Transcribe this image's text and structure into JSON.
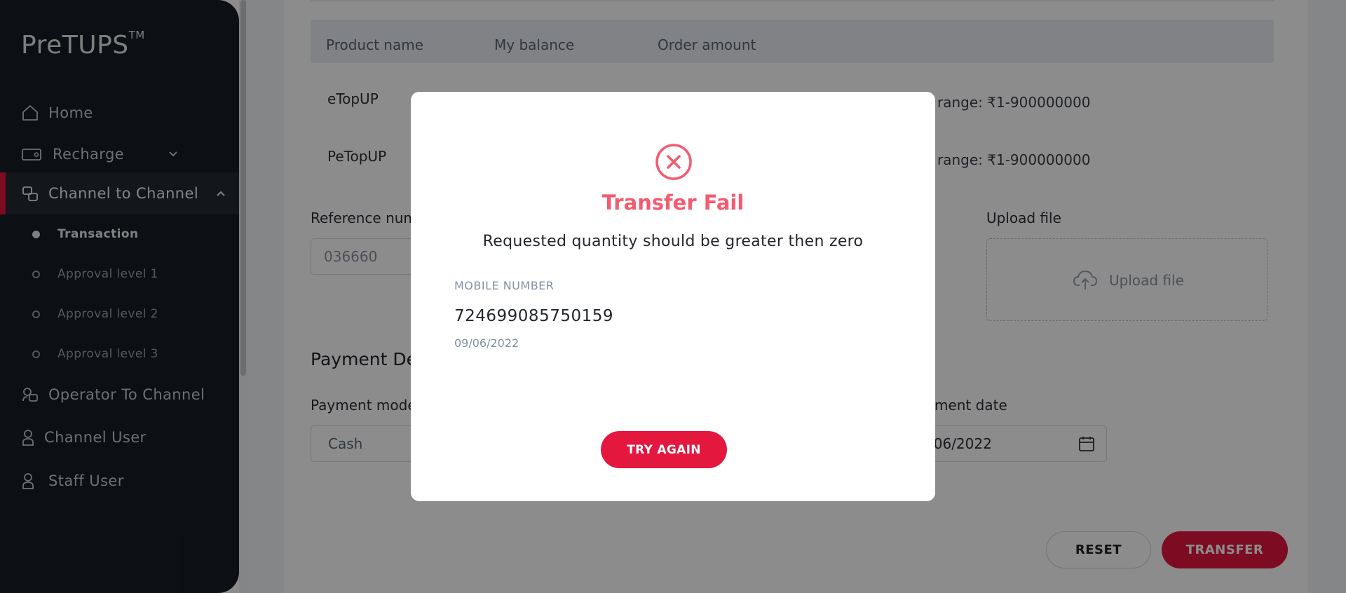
{
  "app": {
    "logo": "PreTUPS",
    "logo_mark": "TM"
  },
  "sidebar": {
    "items": [
      {
        "label": "Home",
        "icon": "home-icon"
      },
      {
        "label": "Recharge",
        "icon": "recharge-icon"
      },
      {
        "label": "Channel to Channel",
        "icon": "channel-to-channel-icon"
      },
      {
        "label": "Operator To Channel",
        "icon": "operator-to-channel-icon"
      },
      {
        "label": "Channel User",
        "icon": "user-icon"
      },
      {
        "label": "Staff User",
        "icon": "user-icon"
      }
    ],
    "sub_items": [
      {
        "label": "Transaction"
      },
      {
        "label": "Approval level 1"
      },
      {
        "label": "Approval level 2"
      },
      {
        "label": "Approval level 3"
      }
    ]
  },
  "table": {
    "headers": [
      "Product name",
      "My balance",
      "Order amount"
    ],
    "rows": [
      {
        "product": "eTopUP",
        "range": "range: ₹1-900000000"
      },
      {
        "product": "PeTopUP",
        "range": "range: ₹1-900000000"
      }
    ]
  },
  "form": {
    "reference_label": "Reference num",
    "reference_value": "036660",
    "upload_label": "Upload file",
    "upload_text": "Upload file",
    "payment_title": "Payment De",
    "payment_mode_label": "Payment mode",
    "payment_mode_value": "Cash",
    "payment_date_label": "ment date",
    "payment_date_value": "/06/2022"
  },
  "actions": {
    "reset": "RESET",
    "transfer": "TRANSFER"
  },
  "modal": {
    "title": "Transfer Fail",
    "message": "Requested quantity should be greater then zero",
    "field_label": "MOBILE NUMBER",
    "field_value": "724699085750159",
    "date": "09/06/2022",
    "button": "TRY AGAIN"
  },
  "colors": {
    "accent": "#e4173e",
    "fail_title": "#f35b6f",
    "sidebar_bg": "#171e25"
  }
}
